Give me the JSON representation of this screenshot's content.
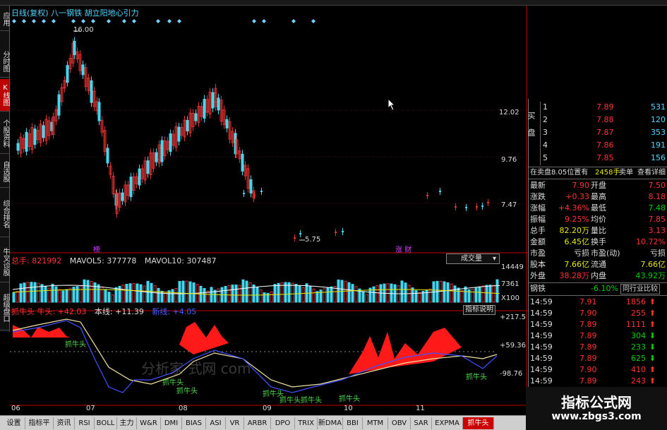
{
  "header": {
    "main_title": "日线(复权) 八一钢铁 胡立阳地心引力",
    "vol_labels": [
      "总手: 821992",
      "MAVOL5: 377778",
      "MAVOL10: 307487"
    ],
    "vol_dropdown": "成交量",
    "ind_labels": [
      "抓牛头 牛头: +42.03",
      "本线: +11.39",
      "新线: +4.05"
    ],
    "ind_button": "指标说明"
  },
  "left_tools": [
    "应用",
    "分时图",
    "K线图",
    "个股资料",
    "自选股",
    "综合排名",
    "牛叉诊股",
    "超级盘口"
  ],
  "price_axis": [
    "12.02",
    "9.76",
    "7.47"
  ],
  "vol_axis": [
    "14449",
    "7361",
    "X100"
  ],
  "ind_axis": [
    "+217.5",
    "+59.36",
    "-98.76"
  ],
  "price_marks": {
    "high": "16.00",
    "low": "5.75",
    "event1": "榜",
    "event2": "涨 财"
  },
  "x_axis": [
    "06",
    "07",
    "08",
    "09",
    "10",
    "11"
  ],
  "ind_texts": [
    "抓牛头",
    "抓牛头",
    "抓牛头",
    "抓牛头",
    "抓牛头",
    "抓牛头",
    "抓牛头",
    "抓牛头"
  ],
  "watermark_text": "分析家 式网 com",
  "panel": {
    "side_label": "买 盘",
    "orders": [
      {
        "n": "1",
        "p": "7.89",
        "v": "531"
      },
      {
        "n": "2",
        "p": "7.88",
        "v": "120"
      },
      {
        "n": "3",
        "p": "7.87",
        "v": "353"
      },
      {
        "n": "4",
        "p": "7.86",
        "v": "191"
      },
      {
        "n": "5",
        "p": "7.85",
        "v": "156"
      }
    ],
    "sell_note": "在卖盘8.05位置有",
    "sell_vol": "2458手",
    "sell_btn": "卖单",
    "detail_btn": "查看详细",
    "stats": [
      [
        "最新",
        "7.90",
        "开盘",
        "7.50"
      ],
      [
        "涨跌",
        "+0.33",
        "最高",
        "8.18"
      ],
      [
        "涨幅",
        "+4.36%",
        "最低",
        "7.48"
      ],
      [
        "振幅",
        "9.25%",
        "均价",
        "7.85"
      ],
      [
        "总手",
        "82.20万",
        "量比",
        "3.13"
      ],
      [
        "金额",
        "6.45亿",
        "换手",
        "10.72%"
      ],
      [
        "市盈",
        "亏损",
        "市盈(动)",
        "亏损"
      ],
      [
        "股本",
        "7.66亿",
        "流通",
        "7.66亿"
      ],
      [
        "外盘",
        "38.28万",
        "内盘",
        "43.92万"
      ]
    ],
    "industry": "钢铁",
    "industry_chg": "-6.10%",
    "compare_btn": "同行业比较",
    "ticks": [
      {
        "t": "14:59",
        "p": "7.91",
        "v": "1856"
      },
      {
        "t": "14:59",
        "p": "7.90",
        "v": "255"
      },
      {
        "t": "14:59",
        "p": "7.89",
        "v": "1111"
      },
      {
        "t": "14:59",
        "p": "7.89",
        "v": "304"
      },
      {
        "t": "14:59",
        "p": "7.89",
        "v": "233"
      },
      {
        "t": "14:59",
        "p": "7.89",
        "v": "625"
      },
      {
        "t": "14:59",
        "p": "7.90",
        "v": "410"
      },
      {
        "t": "14:59",
        "p": "7.89",
        "v": "243"
      }
    ]
  },
  "bottom_tabs": [
    "设置",
    "指标平台",
    "资讯",
    "RSI",
    "BOLL",
    "主力",
    "W&R",
    "DMI",
    "BIAS",
    "ASI",
    "VR",
    "ARBR",
    "DPO",
    "TRIX",
    "新DMA",
    "BBI",
    "MTM",
    "OBV",
    "SAR",
    "EXPMA",
    "抓牛头"
  ],
  "brand": {
    "line1": "指标公式网",
    "line2": "www.zbgs3.com"
  }
}
